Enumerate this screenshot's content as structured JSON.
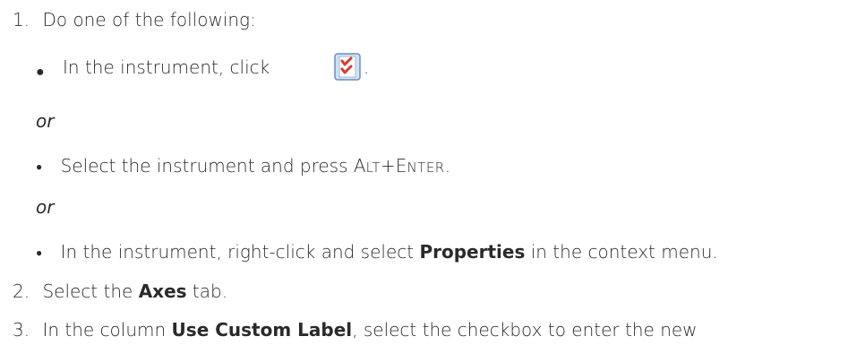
{
  "steps": [
    {
      "number": "1.",
      "text": "Do one of the following:"
    },
    {
      "number": "2.",
      "text_before": "Select the ",
      "bold": "Axes",
      "text_after": " tab."
    },
    {
      "number": "3.",
      "text_before": "In the column ",
      "bold": "Use Custom Label",
      "text_after": ", select the checkbox to enter the new"
    }
  ],
  "bullets": [
    {
      "text_before": "In the instrument, click ",
      "icon": "properties-checklist-icon",
      "text_after": "."
    },
    {
      "text_before": "Select the instrument and press ",
      "key_alt": {
        "A": "A",
        "LT": "LT"
      },
      "plus": "+",
      "key_enter": {
        "E": "E",
        "NTER": "NTER"
      },
      "text_after": "."
    },
    {
      "text_before": "In the instrument, right-click and select ",
      "bold": "Properties",
      "text_after": " in the context menu."
    }
  ],
  "or_label": "or",
  "colors": {
    "text": "#2a2a2a",
    "icon_border": "#6a8fbf",
    "icon_fill": "#cfe2f8",
    "icon_red": "#d83a2e"
  }
}
